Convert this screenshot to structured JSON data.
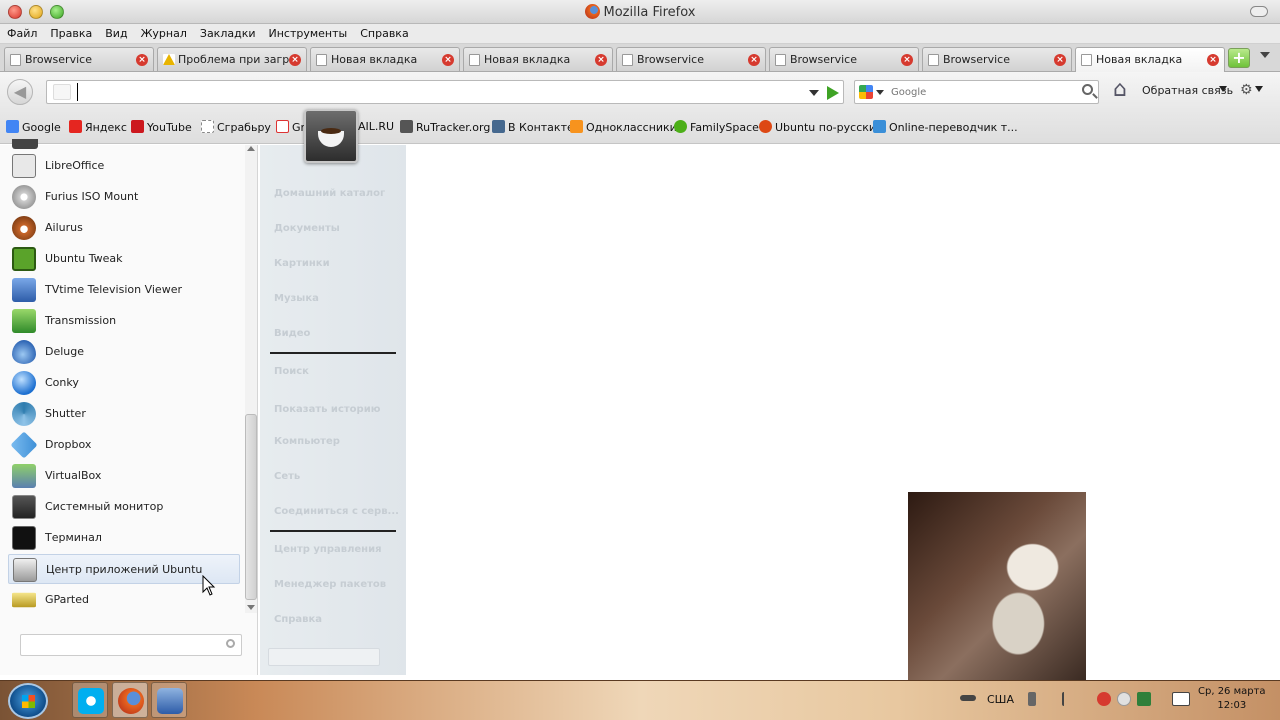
{
  "window": {
    "title": "Mozilla Firefox"
  },
  "menu": [
    "Файл",
    "Правка",
    "Вид",
    "Журнал",
    "Закладки",
    "Инструменты",
    "Справка"
  ],
  "tabs": [
    {
      "label": "Browservice",
      "icon": "page-icon"
    },
    {
      "label": "Проблема при загр...",
      "icon": "warning-icon"
    },
    {
      "label": "Новая вкладка",
      "icon": "page-icon"
    },
    {
      "label": "Новая вкладка",
      "icon": "page-icon"
    },
    {
      "label": "Browservice",
      "icon": "page-icon"
    },
    {
      "label": "Browservice",
      "icon": "page-icon"
    },
    {
      "label": "Browservice",
      "icon": "page-icon"
    },
    {
      "label": "Новая вкладка",
      "icon": "page-icon",
      "active": true
    }
  ],
  "navbar": {
    "url_value": "",
    "search_placeholder": "Google",
    "feedback": "Обратная связь"
  },
  "bookmarks": [
    {
      "label": "Google",
      "color": "#4285f4"
    },
    {
      "label": "Яндекс",
      "color": "#e52620"
    },
    {
      "label": "YouTube",
      "color": "#cc181e"
    },
    {
      "label": "Сграбьру",
      "color": "#888888"
    },
    {
      "label": "Gr",
      "color": "#d33"
    },
    {
      "label": "AIL.RU",
      "color": "#168de2"
    },
    {
      "label": "RuTracker.org",
      "color": "#555555"
    },
    {
      "label": "В Контакте",
      "color": "#45688e"
    },
    {
      "label": "Одноклассники",
      "color": "#f7931e"
    },
    {
      "label": "FamilySpace",
      "color": "#4caf18"
    },
    {
      "label": "Ubuntu по-русски",
      "color": "#dd4814"
    },
    {
      "label": "Online-переводчик т...",
      "color": "#3a8fd8"
    }
  ],
  "apps": [
    {
      "label": "LibreOffice",
      "color": "#e8e8e8"
    },
    {
      "label": "Furius ISO Mount",
      "color": "#cfcfcf"
    },
    {
      "label": "Ailurus",
      "color": "#c8662a"
    },
    {
      "label": "Ubuntu Tweak",
      "color": "#5aa32a"
    },
    {
      "label": "TVtime Television Viewer",
      "color": "#3a6db0"
    },
    {
      "label": "Transmission",
      "color": "#3aa04a"
    },
    {
      "label": "Deluge",
      "color": "#2f66b5"
    },
    {
      "label": "Conky",
      "color": "#1c6fd0"
    },
    {
      "label": "Shutter",
      "color": "#2e7cae"
    },
    {
      "label": "Dropbox",
      "color": "#3d8fd6"
    },
    {
      "label": "VirtualBox",
      "color": "#5a7fb0"
    },
    {
      "label": "Системный монитор",
      "color": "#3a3a3a"
    },
    {
      "label": "Терминал",
      "color": "#111111"
    },
    {
      "label": "Центр приложений Ubuntu",
      "color": "#9a9a9a",
      "hover": true
    },
    {
      "label": "GParted",
      "color": "#d8b23a"
    }
  ],
  "places": [
    "Домашний каталог",
    "Документы",
    "Картинки",
    "Музыка",
    "Видео",
    "Поиск",
    "Показать историю",
    "Компьютер",
    "Сеть",
    "Соединиться с серв...",
    "Центр управления",
    "Менеджер пакетов",
    "Справка"
  ],
  "tray": {
    "lang": "США",
    "date": "Ср, 26 марта",
    "time": "12:03"
  }
}
